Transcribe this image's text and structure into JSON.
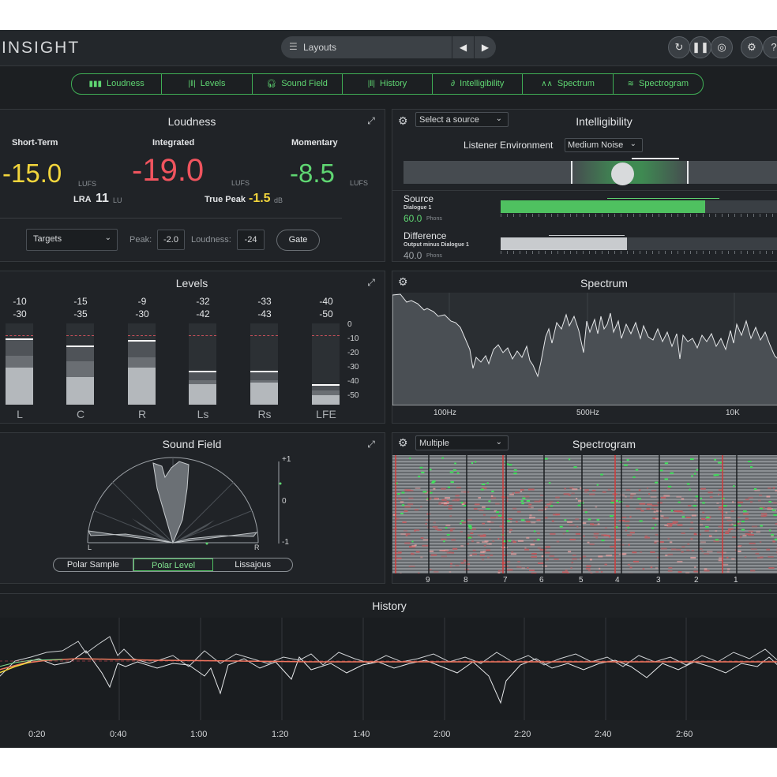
{
  "app": {
    "title": "INSIGHT",
    "layouts_label": "Layouts"
  },
  "tabs": [
    {
      "label": "Loudness",
      "icon": "loudness-icon"
    },
    {
      "label": "Levels",
      "icon": "levels-icon"
    },
    {
      "label": "Sound Field",
      "icon": "headphones-icon"
    },
    {
      "label": "History",
      "icon": "history-icon"
    },
    {
      "label": "Intelligibility",
      "icon": "ear-icon"
    },
    {
      "label": "Spectrum",
      "icon": "spectrum-icon"
    },
    {
      "label": "Spectrogram",
      "icon": "spectrogram-icon"
    }
  ],
  "loudness": {
    "title": "Loudness",
    "short_term_label": "Short-Term",
    "short_term_value": "-15.0",
    "short_term_unit": "LUFS",
    "integrated_label": "Integrated",
    "integrated_value": "-19.0",
    "integrated_unit": "LUFS",
    "momentary_label": "Momentary",
    "momentary_value": "-8.5",
    "momentary_unit": "LUFS",
    "lra_label": "LRA",
    "lra_value": "11",
    "lra_unit": "LU",
    "true_peak_label": "True Peak",
    "true_peak_value": "-1.5",
    "true_peak_unit": "dB",
    "targets_label": "Targets",
    "peak_label": "Peak:",
    "peak_value": "-2.0",
    "loudness_label": "Loudness:",
    "loudness_value": "-24",
    "gate_label": "Gate",
    "colors": {
      "short_term": "#f2d53c",
      "integrated": "#f0545e",
      "momentary": "#5fd672"
    }
  },
  "levels": {
    "title": "Levels",
    "channels": [
      {
        "name": "L",
        "top": "-10",
        "bottom": "-30",
        "peak": 0.8,
        "fill": 0.46
      },
      {
        "name": "C",
        "top": "-15",
        "bottom": "-35",
        "peak": 0.71,
        "fill": 0.34
      },
      {
        "name": "R",
        "top": "-9",
        "bottom": "-30",
        "peak": 0.78,
        "fill": 0.46
      },
      {
        "name": "Ls",
        "top": "-32",
        "bottom": "-42",
        "peak": 0.4,
        "fill": 0.25
      },
      {
        "name": "Rs",
        "top": "-33",
        "bottom": "-43",
        "peak": 0.4,
        "fill": 0.27
      },
      {
        "name": "LFE",
        "top": "-40",
        "bottom": "-50",
        "peak": 0.23,
        "fill": 0.12
      }
    ],
    "scale": [
      "0",
      "-10",
      "-20",
      "-30",
      "-40",
      "-50"
    ]
  },
  "sound_field": {
    "title": "Sound Field",
    "left_label": "L",
    "right_label": "R",
    "scale": [
      "+1",
      "0",
      "-1"
    ],
    "modes": [
      "Polar Sample",
      "Polar Level",
      "Lissajous"
    ],
    "active_mode": "Polar Level"
  },
  "intelligibility": {
    "title": "Intelligibility",
    "source_select": "Select a source",
    "environment_label": "Listener Environment",
    "environment_value": "Medium Noise",
    "source_label": "Source",
    "source_sub": "Dialogue 1",
    "source_value": "60.0",
    "source_unit": "Phons",
    "source_level": 0.73,
    "difference_label": "Difference",
    "difference_sub": "Output minus Dialogue 1",
    "difference_value": "40.0",
    "difference_unit": "Phons",
    "difference_level": 0.45
  },
  "spectrum": {
    "title": "Spectrum",
    "freq_labels": [
      "100Hz",
      "500Hz",
      "10K"
    ]
  },
  "spectrogram": {
    "title": "Spectrogram",
    "select_value": "Multiple",
    "time_labels": [
      "9",
      "8",
      "7",
      "6",
      "5",
      "4",
      "3",
      "2",
      "1"
    ]
  },
  "history": {
    "title": "History",
    "time_labels": [
      "0:20",
      "0:40",
      "1:00",
      "1:20",
      "1:40",
      "2:00",
      "2:20",
      "2:40",
      "2:60"
    ]
  }
}
